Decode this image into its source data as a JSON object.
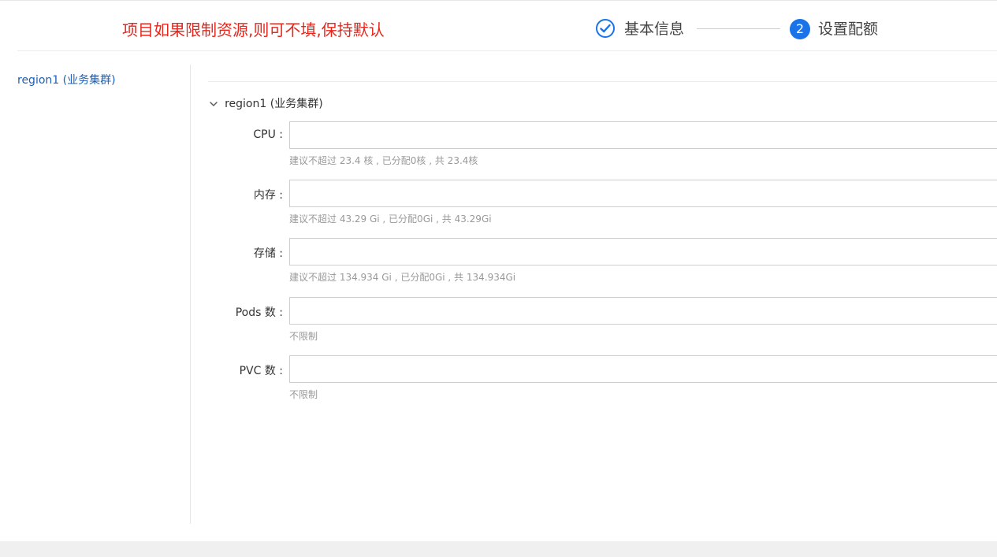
{
  "header": {
    "note": "项目如果限制资源,则可不填,保持默认",
    "steps": [
      {
        "label": "基本信息",
        "status": "done"
      },
      {
        "number": "2",
        "label": "设置配额",
        "status": "active"
      }
    ]
  },
  "sidebar": {
    "items": [
      {
        "label": "region1 (业务集群)"
      }
    ]
  },
  "main": {
    "section": {
      "title": "region1 (业务集群)"
    },
    "fields": [
      {
        "label": "CPU :",
        "value": "",
        "hint": "建议不超过 23.4 核 , 已分配0核 , 共 23.4核"
      },
      {
        "label": "内存 :",
        "value": "",
        "hint": "建议不超过 43.29 Gi , 已分配0Gi , 共 43.29Gi"
      },
      {
        "label": "存储 :",
        "value": "",
        "hint": "建议不超过 134.934 Gi , 已分配0Gi , 共 134.934Gi"
      },
      {
        "label": "Pods 数 :",
        "value": "",
        "hint": "不限制"
      },
      {
        "label": "PVC 数 :",
        "value": "",
        "hint": "不限制"
      }
    ]
  },
  "colors": {
    "accent": "#1a73e8",
    "note": "#e5261c",
    "link": "#1d5fb5",
    "hint": "#999999"
  }
}
